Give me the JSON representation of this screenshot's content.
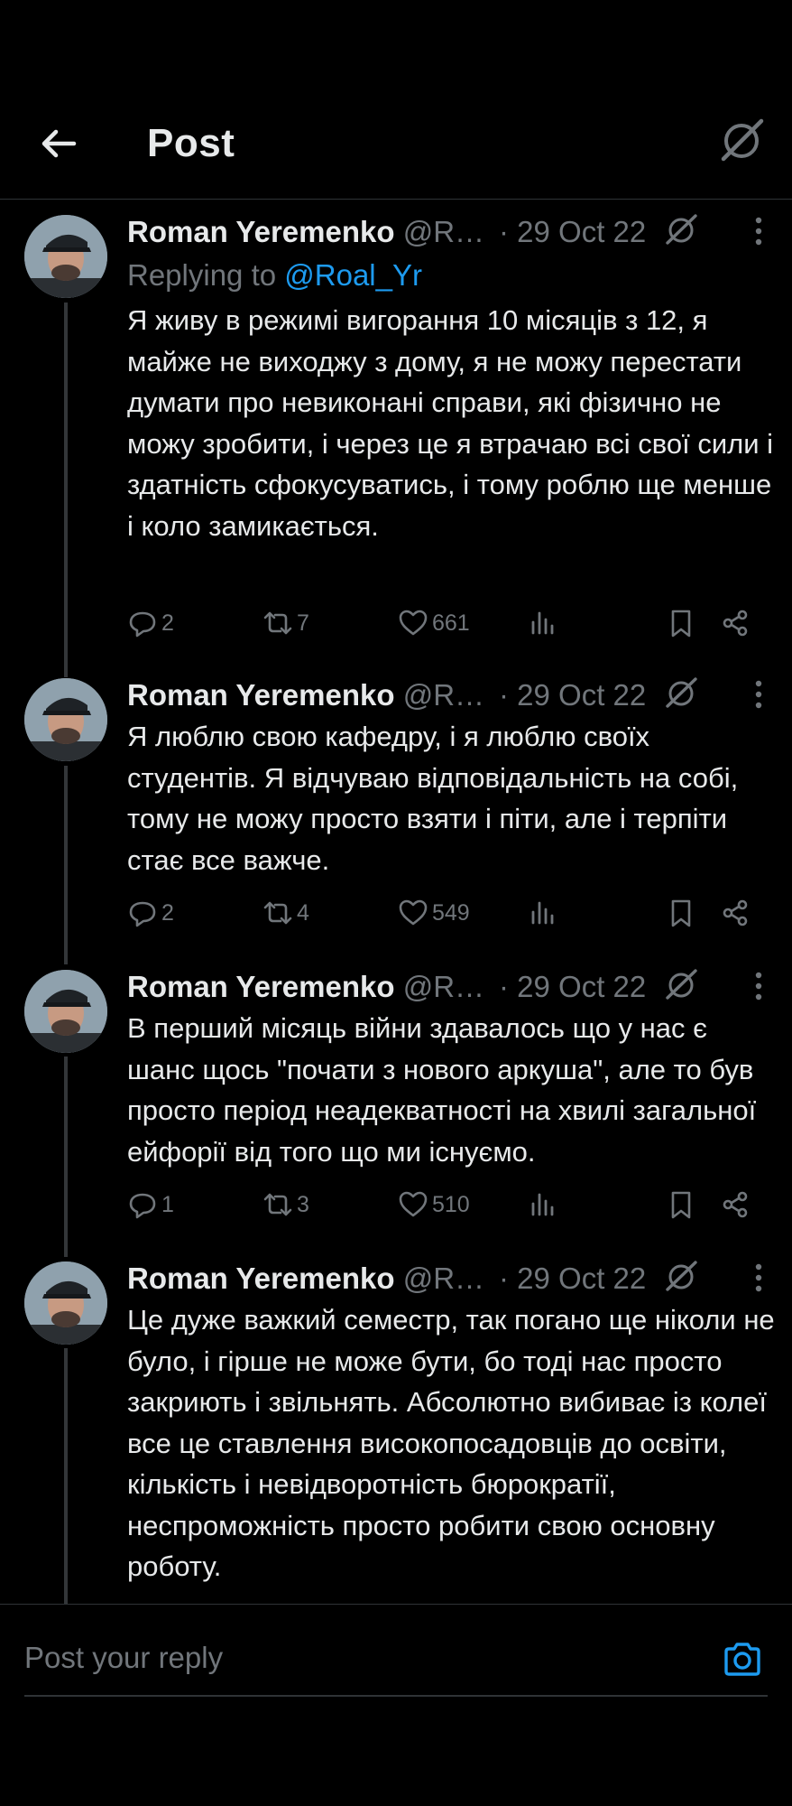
{
  "header": {
    "title": "Post"
  },
  "posts": [
    {
      "name": "Roman Yeremenko",
      "handle": "@R…",
      "date": "· 29 Oct 22",
      "replying_prefix": "Replying to ",
      "replying_handle": "@Roal_Yr",
      "text": "Я живу в режимі вигорання 10 місяців з 12, я майже не виходжу з дому, я не можу перестати думати про невиконані справи, які фізично не можу зробити, і через це я втрачаю всі свої сили і здатність сфокусуватись, і тому роблю ще менше і коло замикається.",
      "replies": "2",
      "reposts": "7",
      "likes": "661"
    },
    {
      "name": "Roman Yeremenko",
      "handle": "@R…",
      "date": "· 29 Oct 22",
      "text": "Я люблю свою кафедру, і я люблю своїх студентів. Я відчуваю відповідальність на собі, тому не можу просто взяти і піти, але і терпіти стає все важче.",
      "replies": "2",
      "reposts": "4",
      "likes": "549"
    },
    {
      "name": "Roman Yeremenko",
      "handle": "@R…",
      "date": "· 29 Oct 22",
      "text": "В перший місяць війни здавалось що у нас є шанс щось \"почати з нового аркуша\", але то був просто період неадекватності на хвилі загальної ейфорії від того що ми існуємо.",
      "replies": "1",
      "reposts": "3",
      "likes": "510"
    },
    {
      "name": "Roman Yeremenko",
      "handle": "@R…",
      "date": "· 29 Oct 22",
      "text": "Це дуже важкий семестр, так погано ще ніколи не було, і гірше не може бути, бо тоді нас просто закриють і звільнять. Абсолютно вибиває із колеї все це ставлення високопосадовців до освіти, кількість і невідворотність бюрократії, неспроможність просто робити свою основну роботу."
    }
  ],
  "reply_bar": {
    "placeholder": "Post your reply"
  },
  "colors": {
    "background": "#000000",
    "text": "#e7e9ea",
    "muted": "#71767b",
    "accent": "#1d9bf0"
  },
  "icons": [
    "back-arrow-icon",
    "grok-icon",
    "more-icon",
    "reply-icon",
    "repost-icon",
    "like-icon",
    "views-icon",
    "bookmark-icon",
    "share-icon",
    "camera-icon"
  ]
}
